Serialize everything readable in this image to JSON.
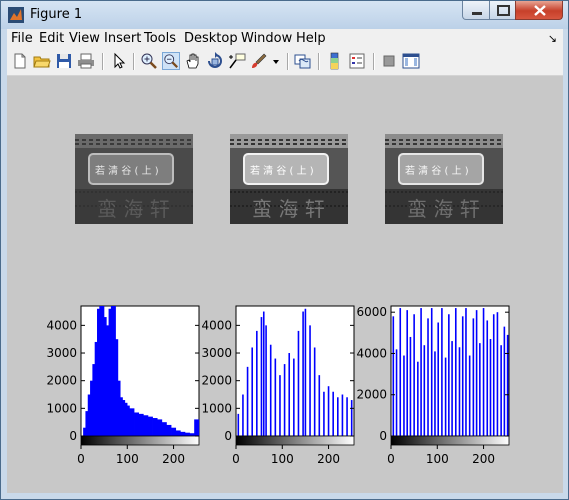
{
  "window": {
    "title": "Figure 1"
  },
  "menu": [
    "File",
    "Edit",
    "View",
    "Insert",
    "Tools",
    "Desktop",
    "Window",
    "Help"
  ],
  "menu_overflow": "↘",
  "toolbar": [
    "new-figure-icon",
    "open-file-icon",
    "save-icon",
    "print-icon",
    "pointer-icon",
    "zoom-in-icon",
    "zoom-out-icon",
    "pan-icon",
    "rotate-3d-icon",
    "data-cursor-icon",
    "brush-icon",
    "brush-dropdown-icon",
    "link-plot-icon",
    "colorbar-icon",
    "legend-icon",
    "hide-plot-tools-icon",
    "show-plot-tools-icon"
  ],
  "chart_data": [
    {
      "type": "bar",
      "title": "",
      "xlim": [
        0,
        255
      ],
      "ylim": [
        0,
        4700
      ],
      "xticks": [
        0,
        100,
        200
      ],
      "yticks": [
        0,
        1000,
        2000,
        3000,
        4000
      ],
      "xtick_labels": [
        "0",
        "100",
        "200"
      ],
      "ytick_labels": [
        "0",
        "1000",
        "2000",
        "3000",
        "4000"
      ],
      "description_series": "histogram of original grayscale image",
      "x": [
        10,
        15,
        20,
        25,
        30,
        35,
        40,
        45,
        50,
        55,
        60,
        65,
        70,
        75,
        80,
        85,
        90,
        95,
        100,
        110,
        120,
        130,
        140,
        150,
        160,
        170,
        180,
        190,
        200,
        210,
        220,
        230,
        240,
        250
      ],
      "values": [
        300,
        900,
        1500,
        2000,
        2600,
        3400,
        4600,
        4700,
        4300,
        3800,
        4000,
        4600,
        4700,
        3500,
        2000,
        1400,
        1300,
        1200,
        1100,
        1000,
        850,
        800,
        750,
        700,
        650,
        600,
        500,
        400,
        300,
        200,
        150,
        120,
        100,
        600
      ]
    },
    {
      "type": "bar",
      "title": "",
      "xlim": [
        0,
        255
      ],
      "ylim": [
        0,
        4700
      ],
      "xticks": [
        0,
        100,
        200
      ],
      "yticks": [
        0,
        1000,
        2000,
        3000,
        4000
      ],
      "xtick_labels": [
        "0",
        "100",
        "200"
      ],
      "ytick_labels": [
        "0",
        "1000",
        "2000",
        "3000",
        "4000"
      ],
      "x": [
        5,
        15,
        25,
        35,
        45,
        55,
        60,
        65,
        75,
        85,
        95,
        105,
        115,
        125,
        135,
        145,
        150,
        160,
        170,
        180,
        190,
        200,
        210,
        220,
        230,
        240,
        250
      ],
      "values": [
        800,
        1500,
        2500,
        3200,
        3800,
        4300,
        4500,
        4000,
        3300,
        2800,
        2200,
        2600,
        3000,
        2800,
        3800,
        4500,
        4600,
        4000,
        3200,
        2200,
        1600,
        1800,
        1600,
        1400,
        1500,
        1400,
        1300
      ]
    },
    {
      "type": "bar",
      "title": "",
      "xlim": [
        0,
        255
      ],
      "ylim": [
        0,
        6300
      ],
      "xticks": [
        0,
        100,
        200
      ],
      "yticks": [
        0,
        2000,
        4000,
        6000
      ],
      "xtick_labels": [
        "0",
        "100",
        "200"
      ],
      "ytick_labels": [
        "0",
        "2000",
        "4000",
        "6000"
      ],
      "x": [
        5,
        12,
        20,
        28,
        35,
        42,
        50,
        58,
        65,
        72,
        80,
        88,
        95,
        102,
        110,
        118,
        125,
        132,
        140,
        148,
        155,
        162,
        170,
        178,
        185,
        192,
        200,
        208,
        215,
        222,
        230,
        238,
        245,
        252
      ],
      "values": [
        5800,
        4200,
        6200,
        3900,
        6100,
        4800,
        5900,
        3600,
        6200,
        4400,
        5700,
        6200,
        4100,
        5500,
        6200,
        3800,
        5900,
        4600,
        6200,
        4300,
        5800,
        6200,
        3900,
        5700,
        6100,
        4500,
        6200,
        5600,
        4700,
        5900,
        6000,
        4400,
        5300,
        4900
      ]
    }
  ]
}
